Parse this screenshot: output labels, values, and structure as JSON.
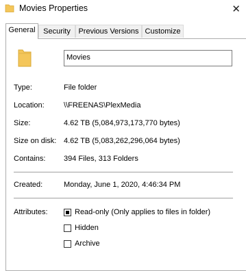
{
  "window": {
    "title": "Movies Properties",
    "close_glyph": "✕"
  },
  "tabs": [
    "General",
    "Security",
    "Previous Versions",
    "Customize"
  ],
  "general": {
    "name_value": "Movies",
    "rows": {
      "type": {
        "label": "Type:",
        "value": "File folder"
      },
      "location": {
        "label": "Location:",
        "value": "\\\\FREENAS\\PlexMedia"
      },
      "size": {
        "label": "Size:",
        "value": "4.62 TB (5,084,973,173,770 bytes)"
      },
      "size_on_disk": {
        "label": "Size on disk:",
        "value": "4.62 TB (5,083,262,296,064 bytes)"
      },
      "contains": {
        "label": "Contains:",
        "value": "394 Files, 313 Folders"
      },
      "created": {
        "label": "Created:",
        "value": "Monday, June 1, 2020, 4:46:34 PM"
      }
    },
    "attributes": {
      "label": "Attributes:",
      "readonly": {
        "label": "Read-only (Only applies to files in folder)",
        "state": "indeterminate"
      },
      "hidden": {
        "label": "Hidden",
        "state": "unchecked"
      },
      "archive": {
        "label": "Archive",
        "state": "unchecked"
      }
    }
  },
  "icons": {
    "title": "folder-icon",
    "big": "folder-icon",
    "folder_color": "#f4c65a"
  }
}
